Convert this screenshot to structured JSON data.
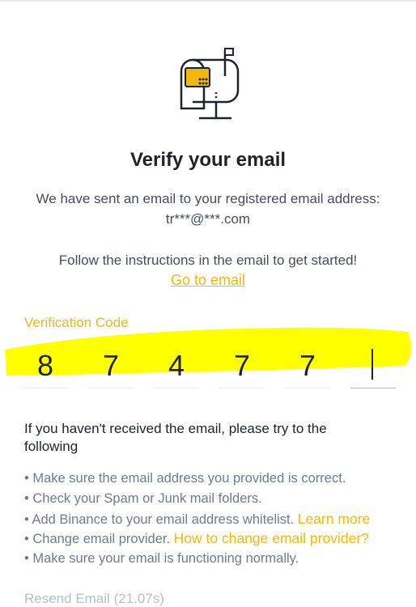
{
  "header": {
    "title": "Verify your email",
    "sent_message": "We have sent an email to your registered email address:",
    "masked_email": "tr***@***.com",
    "instructions": "Follow the instructions in the email to get started!",
    "go_to_email_link": "Go to email"
  },
  "verification": {
    "label": "Verification Code",
    "digits": [
      "8",
      "7",
      "4",
      "7",
      "7",
      ""
    ]
  },
  "help": {
    "title": "If you haven't received the email, please try to the following",
    "tips": [
      {
        "text": "• Make sure the email address you provided is correct."
      },
      {
        "text": "• Check your Spam or Junk mail folders."
      },
      {
        "text": "• Add Binance to your email address whitelist. ",
        "link": "Learn more"
      },
      {
        "text": "• Change email provider. ",
        "link": "How to change email provider?"
      },
      {
        "text": "• Make sure your email is functioning normally."
      }
    ]
  },
  "resend": {
    "label": "Resend Email (21.07s)"
  },
  "colors": {
    "accent": "#f0b90b",
    "highlight": "#ffff00",
    "text": "#1e2329",
    "muted": "#707a8a"
  },
  "icons": {
    "illustration": "mailbox-icon"
  }
}
